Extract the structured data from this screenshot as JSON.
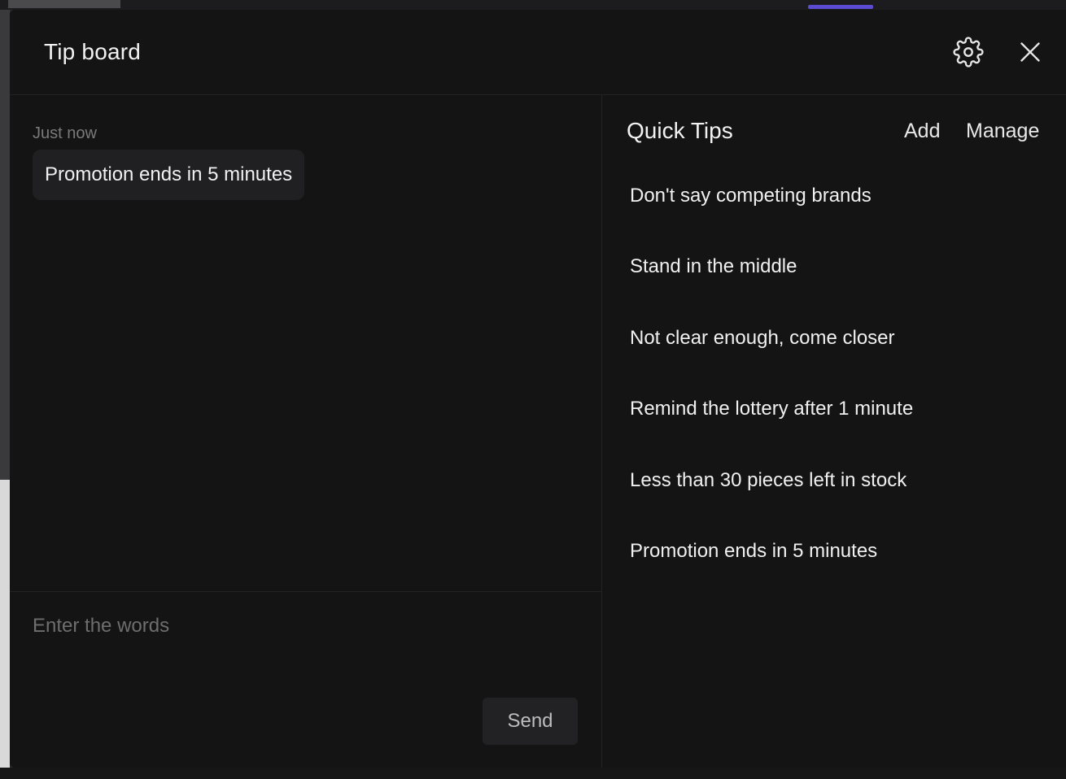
{
  "dialog": {
    "title": "Tip board",
    "settings_icon": "gear-icon",
    "close_icon": "close-icon"
  },
  "messages": [
    {
      "time": "Just now",
      "text": "Promotion ends in 5 minutes"
    }
  ],
  "compose": {
    "placeholder": "Enter the words",
    "value": "",
    "send_label": "Send"
  },
  "quick_tips": {
    "title": "Quick Tips",
    "add_label": "Add",
    "manage_label": "Manage",
    "items": [
      {
        "label": "Don't say competing brands"
      },
      {
        "label": "Stand in the middle"
      },
      {
        "label": "Not clear enough, come closer"
      },
      {
        "label": "Remind the lottery after 1 minute"
      },
      {
        "label": "Less than 30 pieces left in stock"
      },
      {
        "label": "Promotion ends in 5 minutes"
      }
    ]
  },
  "colors": {
    "background": "#141414",
    "bubble": "#202022",
    "accent": "#5b4bd1"
  }
}
